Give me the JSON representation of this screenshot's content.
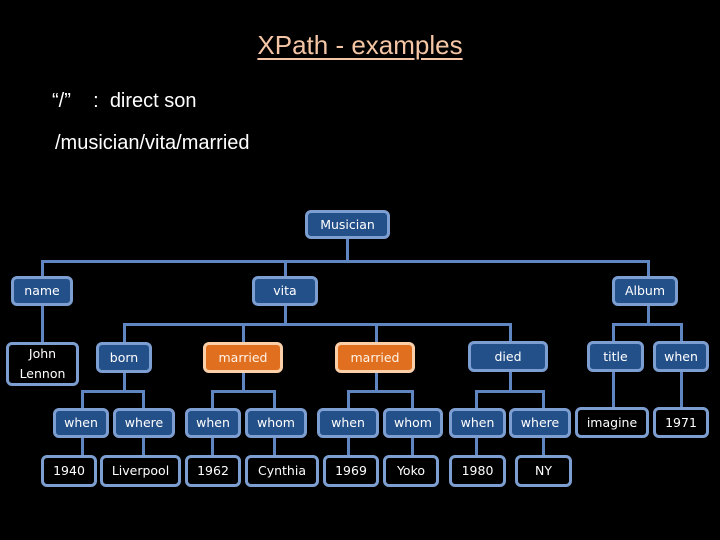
{
  "slide": {
    "title": "XPath - examples",
    "rule_symbol": "“/”",
    "rule_separator": ":",
    "rule_text": "direct son",
    "example_path": "/musician/vita/married"
  },
  "tree": {
    "root": "Musician",
    "level2": {
      "name": "name",
      "vita": "vita",
      "album": "Album"
    },
    "name_value": "John Lennon",
    "vita_children": {
      "born": "born",
      "married_1": "married",
      "married_2": "married",
      "died": "died"
    },
    "album_children": {
      "title": "title",
      "when": "when"
    },
    "born_children": {
      "when": "when",
      "where": "where"
    },
    "married_1_children": {
      "when": "when",
      "whom": "whom"
    },
    "married_2_children": {
      "when": "when",
      "whom": "whom"
    },
    "died_children": {
      "when": "when",
      "where": "where"
    },
    "album_values": {
      "title": "imagine",
      "when": "1971"
    },
    "values": {
      "born_when": "1940",
      "born_where": "Liverpool",
      "married_1_when": "1962",
      "married_1_whom": "Cynthia",
      "married_2_when": "1969",
      "married_2_whom": "Yoko",
      "died_when": "1980",
      "died_where": "NY"
    },
    "highlighted_nodes": [
      "married",
      "married"
    ],
    "colors": {
      "node_fill": "#24508a",
      "node_border": "#7c9ed0",
      "highlight_fill": "#e07020",
      "highlight_border": "#fbd0a8",
      "connector": "#5f86c0",
      "title": "#f5c6a5"
    }
  }
}
